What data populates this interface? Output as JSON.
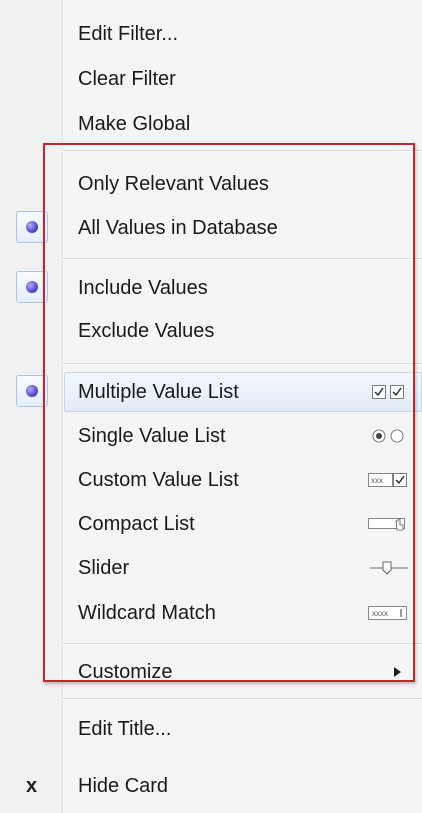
{
  "menu": {
    "items": [
      {
        "label": "Edit Filter..."
      },
      {
        "label": "Clear Filter"
      },
      {
        "label": "Make Global"
      },
      {
        "label": "Only Relevant Values"
      },
      {
        "label": "All Values in Database"
      },
      {
        "label": "Include Values"
      },
      {
        "label": "Exclude Values"
      },
      {
        "label": "Multiple Value List"
      },
      {
        "label": "Single Value List"
      },
      {
        "label": "Custom Value List"
      },
      {
        "label": "Compact List"
      },
      {
        "label": "Slider"
      },
      {
        "label": "Wildcard Match"
      },
      {
        "label": "Customize"
      },
      {
        "label": "Edit Title..."
      },
      {
        "label": "Hide Card",
        "mark": "x"
      }
    ],
    "icon_text": {
      "custom_value_list": "xxx",
      "wildcard_match": "xxxx"
    }
  },
  "colors": {
    "highlight_border": "#c1272d",
    "radio_dot": "#5a4fd1"
  }
}
